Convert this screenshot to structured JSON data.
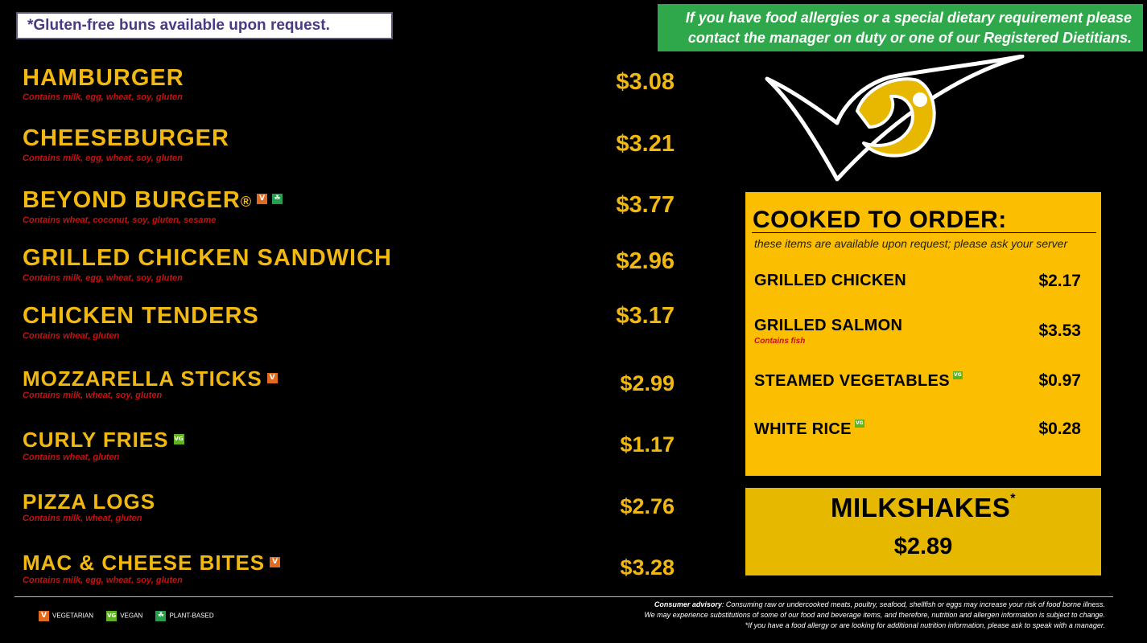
{
  "top": {
    "gluten_free_note": "*Gluten-free buns available upon request.",
    "allergy_notice_line1": "If you have food allergies or a special dietary requirement please",
    "allergy_notice_line2": "contact the manager on duty or one of our Registered Dietitians."
  },
  "menu": [
    {
      "name": "HAMBURGER",
      "allergens": "Contains milk, egg, wheat, soy, gluten",
      "price": "$3.08",
      "badges": []
    },
    {
      "name": "CHEESEBURGER",
      "allergens": "Contains milk, egg, wheat, soy, gluten",
      "price": "$3.21",
      "badges": []
    },
    {
      "name": "BEYOND BURGER",
      "registered": "®",
      "allergens": "Contains wheat, coconut, soy, gluten, sesame",
      "price": "$3.77",
      "badges": [
        "V",
        "PB"
      ]
    },
    {
      "name": "GRILLED CHICKEN SANDWICH",
      "allergens": "Contains milk, egg, wheat, soy, gluten",
      "price": "$2.96",
      "badges": []
    },
    {
      "name": "CHICKEN TENDERS",
      "allergens": "Contains wheat, gluten",
      "price": "$3.17",
      "badges": []
    },
    {
      "name": "MOZZARELLA STICKS",
      "allergens": "Contains milk, wheat, soy, gluten",
      "price": "$2.99",
      "badges": [
        "V"
      ]
    },
    {
      "name": "CURLY FRIES",
      "allergens": "Contains wheat, gluten",
      "price": "$1.17",
      "badges": [
        "VG"
      ]
    },
    {
      "name": "PIZZA LOGS",
      "allergens": "Contains milk, wheat, gluten",
      "price": "$2.76",
      "badges": []
    },
    {
      "name": "MAC & CHEESE BITES",
      "allergens": "Contains milk, egg, wheat, soy, gluten",
      "price": "$3.28",
      "badges": [
        "V"
      ]
    }
  ],
  "cooked_to_order": {
    "title": "COOKED TO ORDER:",
    "subtitle": "these items are available upon request; please ask your server",
    "items": [
      {
        "name": "GRILLED CHICKEN",
        "price": "$2.17"
      },
      {
        "name": "GRILLED SALMON",
        "allergens": "Contains fish",
        "price": "$3.53"
      },
      {
        "name": "STEAMED VEGETABLES",
        "price": "$0.97",
        "badges": [
          "VG"
        ]
      },
      {
        "name": "WHITE RICE",
        "price": "$0.28",
        "badges": [
          "VG"
        ]
      }
    ]
  },
  "milkshakes": {
    "title": "MILKSHAKES",
    "asterisk": "*",
    "price": "$2.89"
  },
  "legend": {
    "vegetarian": {
      "badge": "V",
      "label": "VEGETARIAN"
    },
    "vegan": {
      "badge": "VG",
      "label": "VEGAN"
    },
    "plant_based": {
      "badge": "PB",
      "label": "PLANT-BASED"
    }
  },
  "advisory": {
    "lead": "Consumer advisory",
    "line1": ": Consuming raw or undercooked meats, poultry, seafood, shellfish or eggs may increase your risk of food borne illness.",
    "line2": "We may experience substitutions of some of our food and beverage items, and therefore, nutrition and allergen information is subject to change.",
    "line3": "*If you have a food allergy or are looking for additional nutrition information, please ask to speak with a manager."
  },
  "colors": {
    "background": "#000000",
    "menu_text": "#f1b811",
    "allergen_text": "#c81010",
    "panel": "#fbbe00",
    "notice_green": "#2ea84a"
  }
}
